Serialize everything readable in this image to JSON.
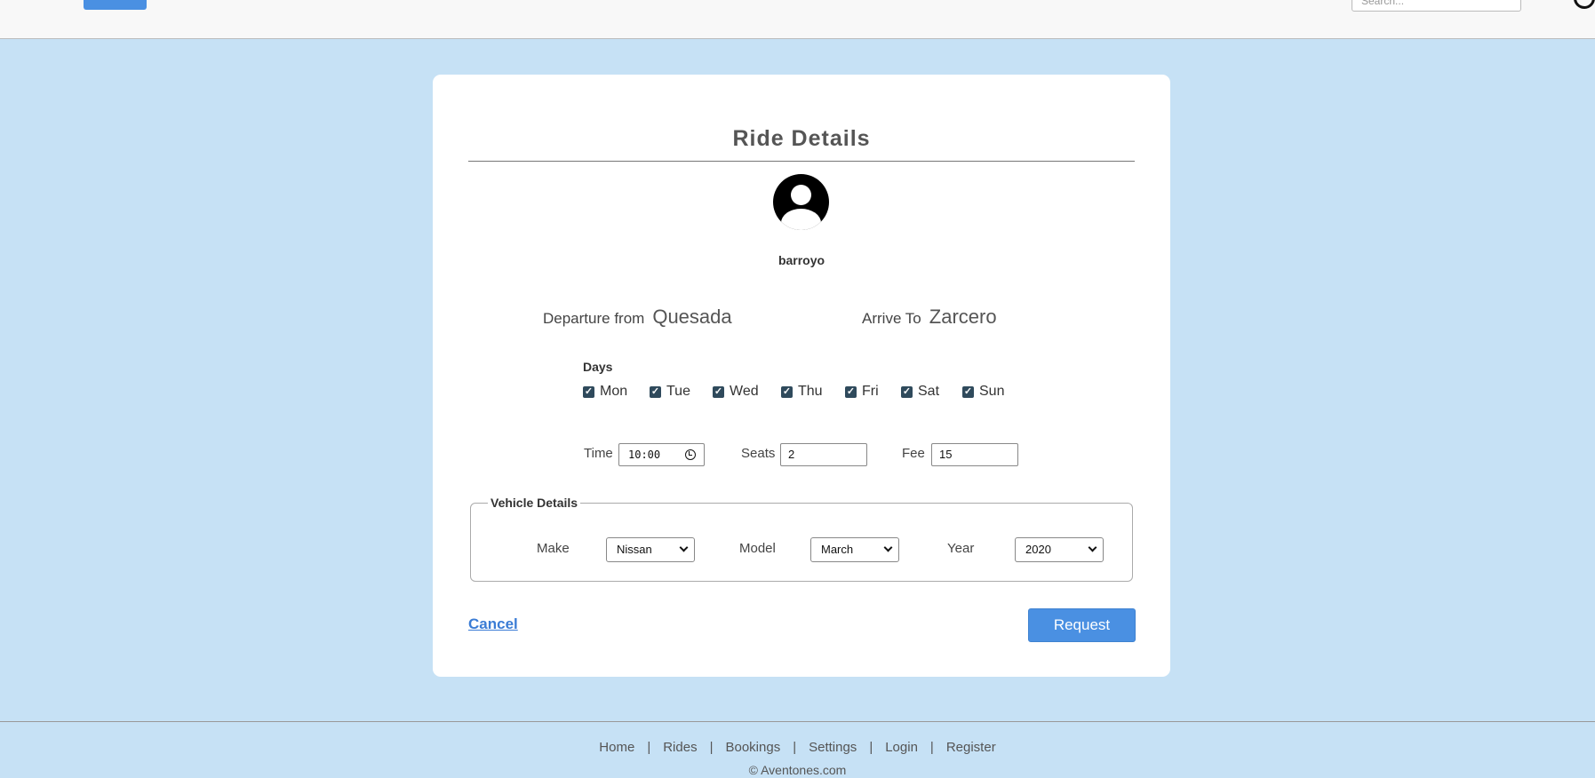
{
  "header": {
    "search_placeholder": "Search..."
  },
  "form": {
    "title": "Ride Details",
    "username": "barroyo",
    "departure_label": "Departure from",
    "departure_value": "Quesada",
    "arrive_label": "Arrive To",
    "arrive_value": "Zarcero",
    "days_label": "Days",
    "days": [
      {
        "label": "Mon",
        "checked": true
      },
      {
        "label": "Tue",
        "checked": true
      },
      {
        "label": "Wed",
        "checked": true
      },
      {
        "label": "Thu",
        "checked": true
      },
      {
        "label": "Fri",
        "checked": true
      },
      {
        "label": "Sat",
        "checked": true
      },
      {
        "label": "Sun",
        "checked": true
      }
    ],
    "time_label": "Time",
    "time_value": "10:00",
    "seats_label": "Seats",
    "seats_value": "2",
    "fee_label": "Fee",
    "fee_value": "15",
    "vehicle": {
      "legend": "Vehicle Details",
      "make_label": "Make",
      "make_value": "Nissan",
      "model_label": "Model",
      "model_value": "March",
      "year_label": "Year",
      "year_value": "2020"
    },
    "cancel_label": "Cancel",
    "request_label": "Request"
  },
  "footer": {
    "links": [
      "Home",
      "Rides",
      "Bookings",
      "Settings",
      "Login",
      "Register"
    ],
    "separator": "|",
    "copyright": "© Aventones.com"
  },
  "colors": {
    "page_background": "#c6e1f5",
    "accent": "#4a90e2",
    "checkbox": "#2f4a5c"
  }
}
